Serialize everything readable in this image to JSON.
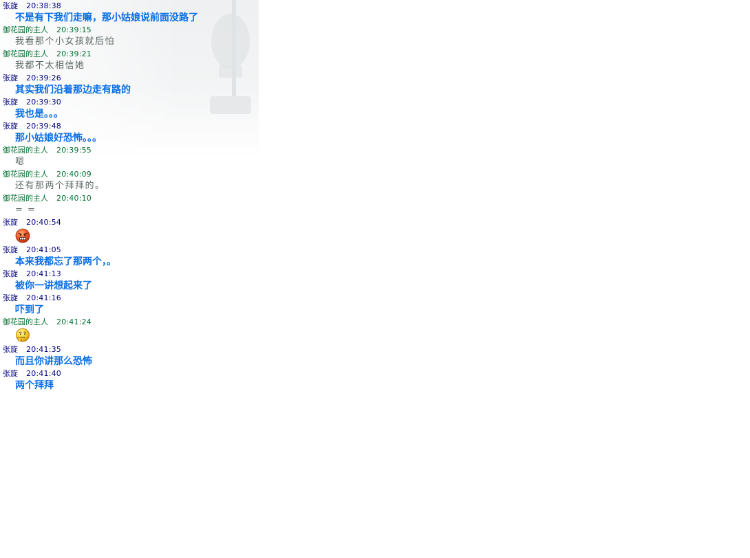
{
  "colors": {
    "sender_zhang": "#00007f",
    "sender_host": "#006f2f",
    "text_zhang": "#0a6fe6",
    "text_host": "#5f6a66"
  },
  "messages": [
    {
      "sender": "张旋",
      "time": "20:38:38",
      "kind": "text",
      "text": "不是有下我们走嘛，那小姑娘说前面没路了"
    },
    {
      "sender": "御花园的主人",
      "time": "20:39:15",
      "kind": "text",
      "text": "我看那个小女孩就后怕"
    },
    {
      "sender": "御花园的主人",
      "time": "20:39:21",
      "kind": "text",
      "text": "我都不太相信她"
    },
    {
      "sender": "张旋",
      "time": "20:39:26",
      "kind": "text",
      "text": "其实我们沿着那边走有路的"
    },
    {
      "sender": "张旋",
      "time": "20:39:30",
      "kind": "text",
      "text": "我也是。。。"
    },
    {
      "sender": "张旋",
      "time": "20:39:48",
      "kind": "text",
      "text": "那小姑娘好恐怖。。。"
    },
    {
      "sender": "御花园的主人",
      "time": "20:39:55",
      "kind": "text",
      "text": "嗯"
    },
    {
      "sender": "御花园的主人",
      "time": "20:40:09",
      "kind": "text",
      "text": "还有那两个拜拜的。"
    },
    {
      "sender": "御花园的主人",
      "time": "20:40:10",
      "kind": "text",
      "text": "= ="
    },
    {
      "sender": "张旋",
      "time": "20:40:54",
      "kind": "emoji",
      "icon": "angry-face-icon"
    },
    {
      "sender": "张旋",
      "time": "20:41:05",
      "kind": "text",
      "text": "本来我都忘了那两个，。"
    },
    {
      "sender": "张旋",
      "time": "20:41:13",
      "kind": "text",
      "text": "被你一讲想起来了"
    },
    {
      "sender": "张旋",
      "time": "20:41:16",
      "kind": "text",
      "text": "吓到了"
    },
    {
      "sender": "御花园的主人",
      "time": "20:41:24",
      "kind": "emoji",
      "icon": "thinking-face-icon"
    },
    {
      "sender": "张旋",
      "time": "20:41:35",
      "kind": "text",
      "text": "而且你讲那么恐怖"
    },
    {
      "sender": "张旋",
      "time": "20:41:40",
      "kind": "text",
      "text": "两个拜拜"
    }
  ]
}
